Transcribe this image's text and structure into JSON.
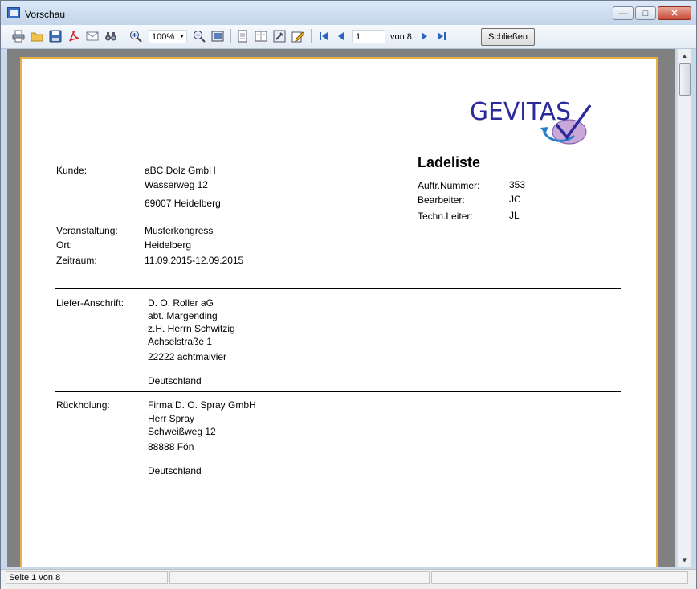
{
  "window": {
    "title": "Vorschau"
  },
  "toolbar": {
    "zoom": "100%",
    "page_number": "1",
    "page_of": "von 8",
    "close_label": "Schließen"
  },
  "logo": {
    "text": "GEVITAS"
  },
  "document": {
    "title": "Ladeliste",
    "meta": [
      {
        "label": "Auftr.Nummer:",
        "value": "353"
      },
      {
        "label": "Bearbeiter:",
        "value": "JC"
      },
      {
        "label": "Techn.Leiter:",
        "value": "JL"
      }
    ],
    "customer": {
      "label": "Kunde:",
      "name": "aBC Dolz GmbH",
      "street": "Wasserweg 12",
      "city": "69007 Heidelberg"
    },
    "event": [
      {
        "label": "Veranstaltung:",
        "value": "Musterkongress"
      },
      {
        "label": "Ort:",
        "value": "Heidelberg"
      },
      {
        "label": "Zeitraum:",
        "value": "11.09.2015-12.09.2015"
      }
    ],
    "delivery": {
      "label": "Liefer-Anschrift:",
      "lines": [
        "D. O. Roller aG",
        "abt. Margending",
        "z.H. Herrn Schwitzig",
        "Achselstraße 1",
        "22222 achtmalvier"
      ],
      "country": "Deutschland"
    },
    "pickup": {
      "label": "Rückholung:",
      "lines": [
        "Firma D. O. Spray GmbH",
        "Herr Spray",
        "Schweißweg 12",
        "88888 Fön"
      ],
      "country": "Deutschland"
    }
  },
  "status": {
    "page": "Seite 1 von 8"
  }
}
